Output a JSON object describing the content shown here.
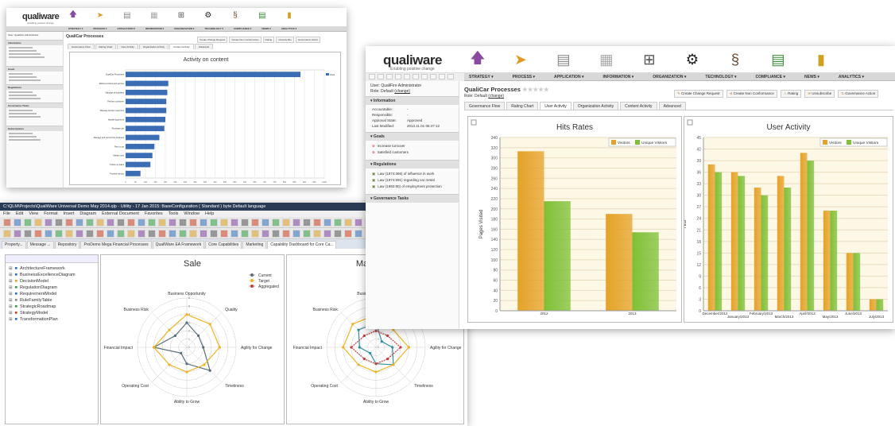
{
  "logo": {
    "name": "qualiware",
    "tagline": "Enabling positive change"
  },
  "modules": [
    "Strategy",
    "Process",
    "Application",
    "Information",
    "Organization",
    "Technology",
    "Compliance",
    "News",
    "Analytics"
  ],
  "menu": [
    "STRATEGY ▾",
    "PROCESS ▾",
    "APPLICATION ▾",
    "INFORMATION ▾",
    "ORGANIZATION ▾",
    "TECHNOLOGY ▾",
    "COMPLIANCE ▾",
    "NEWS ▾",
    "ANALYTICS ▾"
  ],
  "page": {
    "user": "User: QualiFire Administrator",
    "role": "Role: Default",
    "role_link": "(change)",
    "title": "QualiCar Processes",
    "stars": "★★★★★"
  },
  "info": {
    "header": "Information",
    "rows": [
      {
        "k": "Accountable:",
        "v": "-"
      },
      {
        "k": "Responsible:",
        "v": "-"
      },
      {
        "k": "Approval State:",
        "v": "Approved"
      },
      {
        "k": "Last Modified:",
        "v": "2013.11.01 06:47:12"
      }
    ]
  },
  "goals": {
    "header": "Goals",
    "items": [
      "Increase turnover",
      "Satisfied customers"
    ]
  },
  "regs": {
    "header": "Regulations",
    "items": [
      "Law (1874:366) of influence in work",
      "Law (1974:591) regarding car rental",
      "Law (1992:80) of employment protection"
    ]
  },
  "gov": {
    "header": "Governance Tasks"
  },
  "tabs": [
    "Governance Flow",
    "Rating Chart",
    "User Activity",
    "Organization Activity",
    "Content Activity",
    "Advanced"
  ],
  "actions": [
    "Create Change Request",
    "Create Non Conformance",
    "Rating",
    "Unsubscribe",
    "Governance Action"
  ],
  "w1": {
    "tabs": [
      "Governance Flow",
      "Rating Chart",
      "User Activity",
      "Organization Activity",
      "Content Activity",
      "Advanced"
    ],
    "actions": [
      "Create Change Request",
      "Create Non Conformance",
      "Rating",
      "Unsubscribe",
      "Governance Action"
    ],
    "side_sections": [
      "Information",
      "Goals",
      "Regulations",
      "Governance Tasks",
      "Subscriptions"
    ]
  },
  "chart_data": [
    {
      "type": "bar",
      "title": "Activity on content",
      "orientation": "horizontal",
      "legend": [
        "Visits"
      ],
      "categories": [
        "QualiCar Processes",
        "Market product and service",
        "Manage all activities",
        "Perform customer",
        "Manage human resources",
        "Handle payments",
        "Purchase car",
        "Manage and control the business",
        "Rent a car",
        "Market cars",
        "Follow up sales",
        "Provide service"
      ],
      "values": [
        880,
        215,
        210,
        205,
        205,
        200,
        195,
        170,
        145,
        135,
        125,
        75
      ],
      "xlim": [
        0,
        1000
      ],
      "xticks": [
        "0",
        "50",
        "100",
        "150",
        "200",
        "250",
        "300",
        "350",
        "400",
        "450",
        "500",
        "550",
        "600",
        "650",
        "700",
        "750",
        "800",
        "850",
        "900",
        "950",
        "1000"
      ],
      "series_color": "#3a6db3"
    },
    {
      "type": "bar",
      "title": "Hits Rates",
      "ylabel": "Pages Visited",
      "categories": [
        "2012",
        "2013"
      ],
      "series": [
        {
          "name": "Visitors",
          "values": [
            313,
            190
          ],
          "color": "#e5a227"
        },
        {
          "name": "Unique Visitors",
          "values": [
            215,
            154
          ],
          "color": "#7fc036"
        }
      ],
      "ylim": [
        0,
        340
      ],
      "yticks": [
        0,
        20,
        40,
        60,
        80,
        100,
        120,
        140,
        160,
        180,
        200,
        220,
        240,
        260,
        280,
        300,
        320,
        340
      ],
      "legend": "top-right",
      "grid": true
    },
    {
      "type": "bar",
      "title": "User Activity",
      "ylabel": "Hits",
      "categories": [
        "December/2012",
        "January/2013",
        "February/2013",
        "March/2013",
        "April/2013",
        "May/2013",
        "June/2013",
        "July/2013"
      ],
      "series": [
        {
          "name": "Visitors",
          "values": [
            38,
            36,
            32,
            35,
            41,
            26,
            15,
            3
          ],
          "color": "#e5a227"
        },
        {
          "name": "Unique Visitors",
          "values": [
            36,
            35,
            30,
            32,
            39,
            26,
            15,
            3
          ],
          "color": "#7fc036"
        }
      ],
      "ylim": [
        0,
        45
      ],
      "yticks": [
        0,
        3,
        6,
        9,
        12,
        15,
        18,
        21,
        24,
        27,
        30,
        33,
        36,
        39,
        42,
        45
      ],
      "legend": "top-right",
      "grid": true
    },
    {
      "type": "radar",
      "title": "Sale",
      "axes": [
        "Business Opportunity",
        "Quality",
        "Agility for Change",
        "Timeliness",
        "Ability to Grow",
        "Operating Cost",
        "Financial Impact",
        "Business Risk"
      ],
      "rmax": 6,
      "rticks": [
        "0",
        "1",
        "2",
        "3",
        "4",
        "5",
        "6"
      ],
      "series": [
        {
          "name": "Current",
          "values": [
            3,
            2,
            2,
            4,
            2,
            1,
            4,
            2
          ],
          "color": "#5a6e7a"
        },
        {
          "name": "Target",
          "values": [
            4,
            4,
            4,
            3,
            3,
            3,
            4,
            3
          ],
          "color": "#f0b21e"
        },
        {
          "name": "Aggregated",
          "values": [
            0,
            0,
            0,
            0,
            0,
            0,
            0,
            0
          ],
          "color": "#c04040"
        }
      ]
    },
    {
      "type": "radar",
      "title": "Marketing",
      "axes": [
        "Business Opportunity",
        "Quality",
        "Agility for Change",
        "Timeliness",
        "Ability to Grow",
        "Operating Cost",
        "Financial Impact",
        "Business Risk"
      ],
      "rmax": 6,
      "rticks": [
        "0",
        "1",
        "2",
        "3",
        "4",
        "5",
        "6"
      ],
      "series": [
        {
          "name": "Current",
          "values": [
            3,
            1,
            2,
            3,
            2,
            1,
            2,
            3
          ],
          "color": "#2f8fa0"
        },
        {
          "name": "Target",
          "values": [
            4,
            3,
            4,
            3,
            3,
            3,
            4,
            4
          ],
          "color": "#f0b21e"
        },
        {
          "name": "Aggregated",
          "values": [
            2,
            2,
            3,
            2,
            2,
            2,
            3,
            2
          ],
          "color": "#c04040"
        }
      ]
    }
  ],
  "w3": {
    "title": "C:\\QLM\\Projects\\QualiWare Universal Demo May 2014.qlp - Utility - 17 Jan 2015: BaseConfiguration ( Standard ) byte Default language",
    "menu": [
      "File",
      "Edit",
      "View",
      "Format",
      "Insert",
      "Diagram",
      "External Document",
      "Favorites",
      "Tools",
      "Window",
      "Help"
    ],
    "tabs": [
      "Property...",
      "Message ...",
      "Repository",
      "ProDemo Mega Financial Processes",
      "QualiWare EA Framework",
      "Core Capabilities",
      "Marketing",
      "Capability Dashboard for Core Ca..."
    ],
    "tree": [
      "ArchitectureFramework",
      "BusinessExcellenceDiagram",
      "DecisionModel",
      "RegulationDiagram",
      "RequirementModel",
      "RuleFamilyTable",
      "StrategicRoadmap",
      "StrategyModel",
      "TransformationPlan"
    ]
  }
}
